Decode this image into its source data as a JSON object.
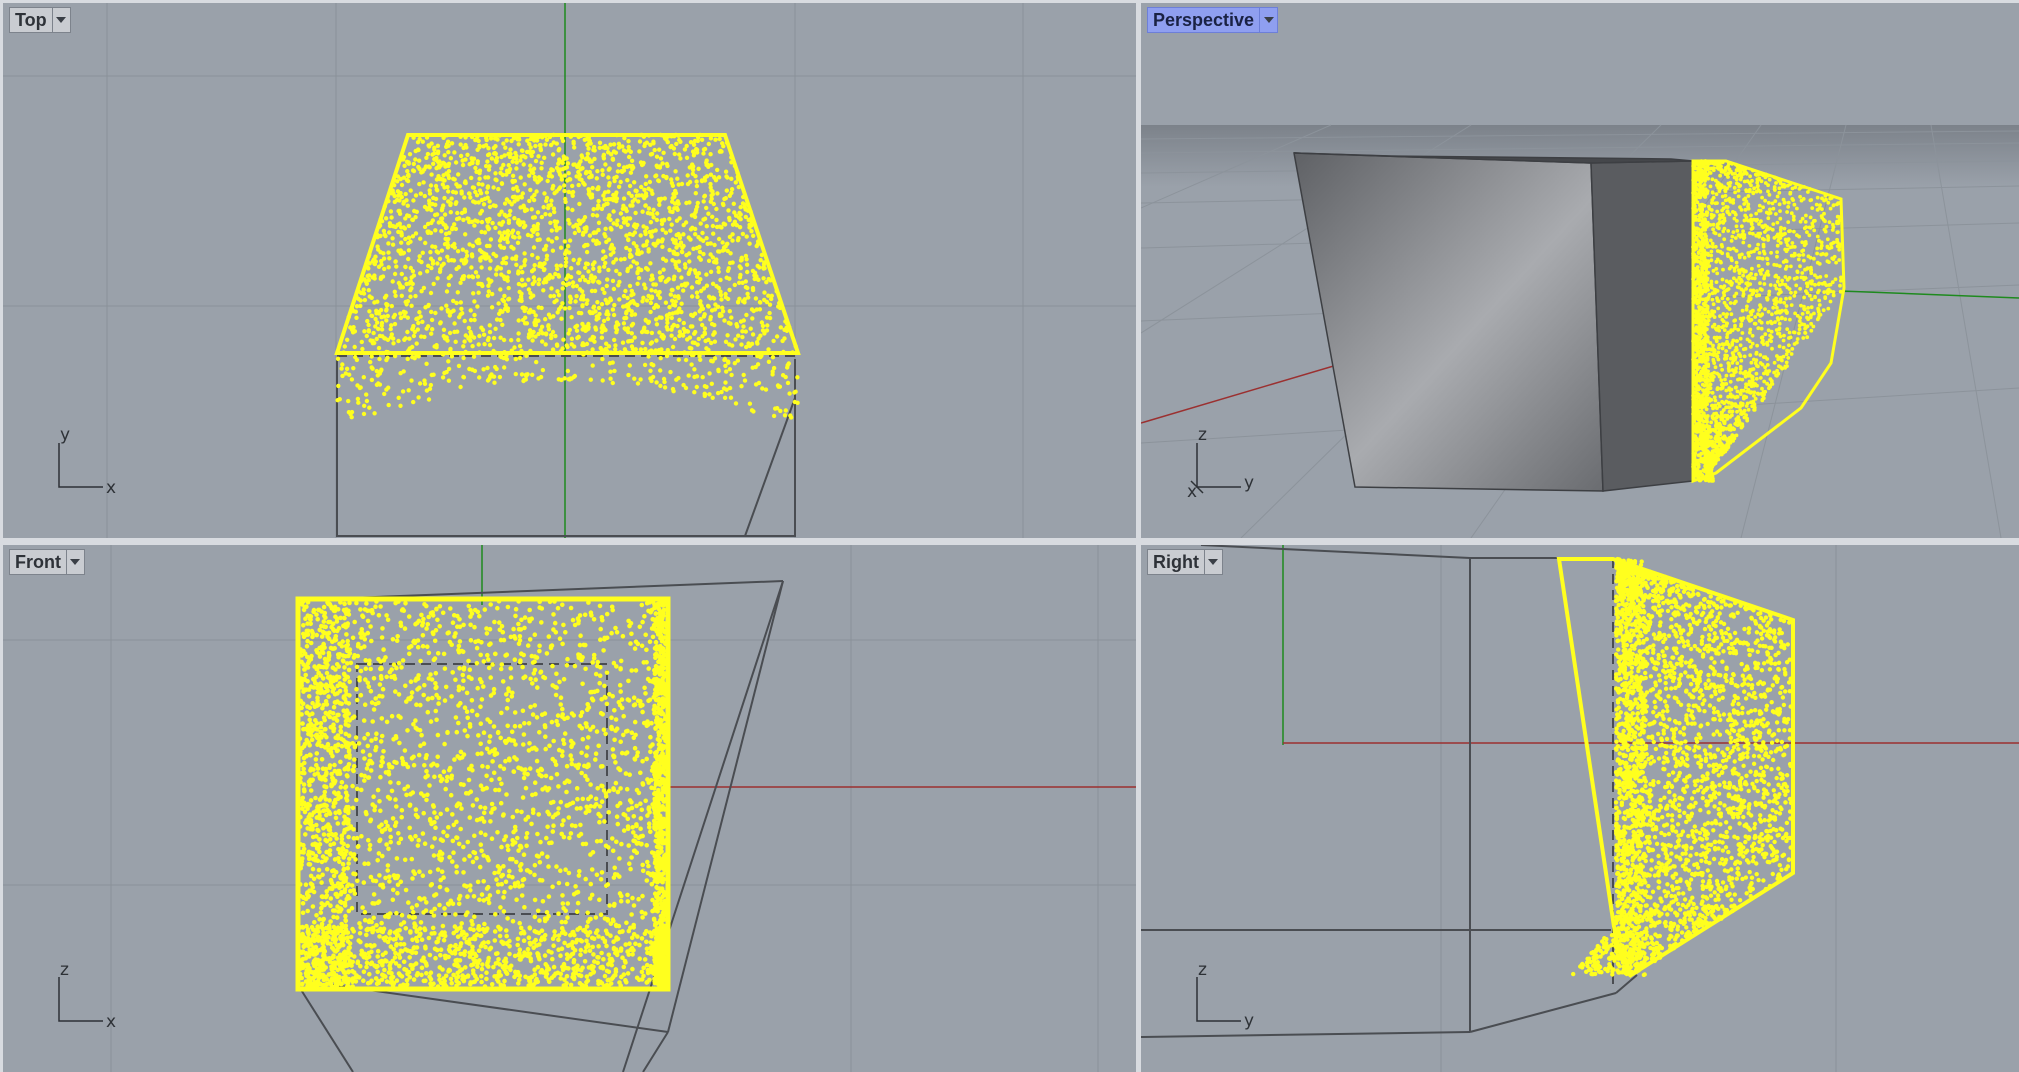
{
  "viewports": {
    "top": {
      "label": "Top",
      "axis": {
        "h": "x",
        "v": "y"
      }
    },
    "perspective": {
      "label": "Perspective",
      "axis": {
        "h": "y",
        "v": "z",
        "d": "x"
      },
      "active": true
    },
    "front": {
      "label": "Front",
      "axis": {
        "h": "x",
        "v": "z"
      }
    },
    "right": {
      "label": "Right",
      "axis": {
        "h": "y",
        "v": "z"
      }
    }
  },
  "colors": {
    "viewport_bg": "#9aa1aa",
    "grid": "#8a9199",
    "points": "#ffff1e",
    "x_axis": "#9b3030",
    "y_axis": "#1e8a1e",
    "wireframe": "#4a4d52",
    "active_tab": "#8f9ff0"
  }
}
